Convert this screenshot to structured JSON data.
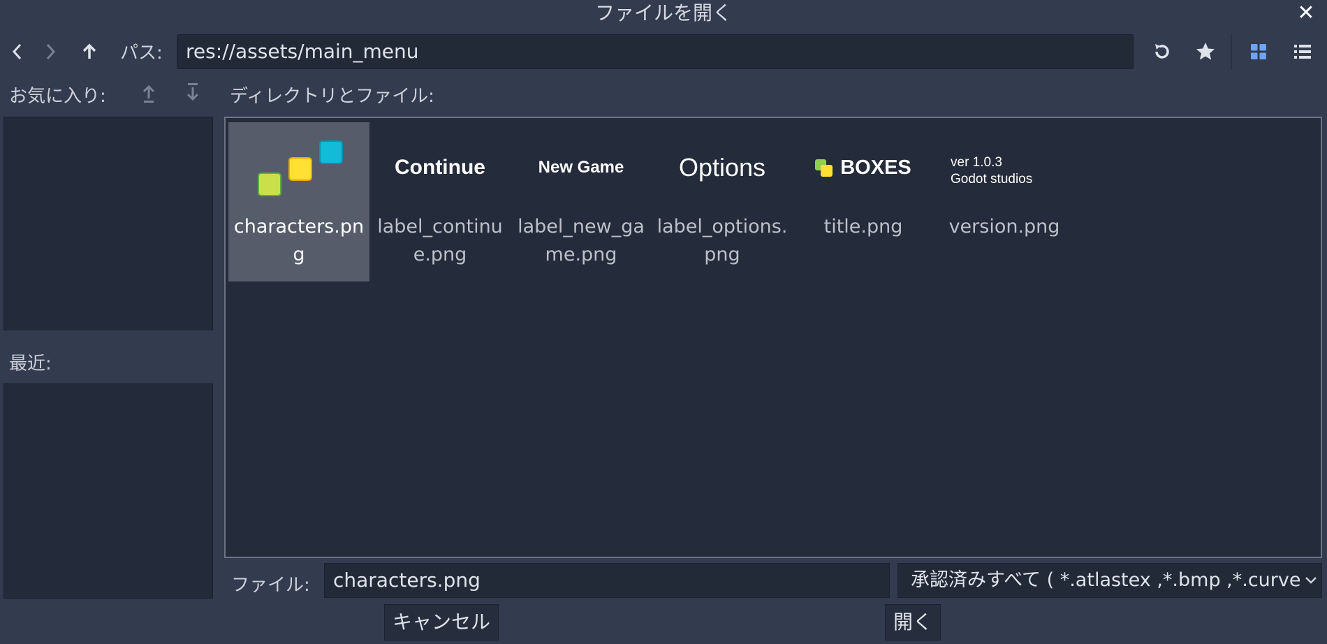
{
  "window": {
    "title": "ファイルを開く",
    "close_icon": "close-icon"
  },
  "toolbar": {
    "back_icon": "chevron-left-icon",
    "forward_icon": "chevron-right-icon",
    "up_icon": "arrow-up-icon",
    "path_label": "パス:",
    "path_value": "res://assets/main_menu",
    "refresh_icon": "refresh-icon",
    "favorite_icon": "star-icon",
    "grid_view_icon": "grid-view-icon",
    "list_view_icon": "list-view-icon"
  },
  "sidebar": {
    "favorites_label": "お気に入り:",
    "move_up_icon": "move-up-icon",
    "move_down_icon": "move-down-icon",
    "recent_label": "最近:"
  },
  "main": {
    "dir_label": "ディレクトリとファイル:",
    "files": [
      {
        "name": "characters.png",
        "selected": true
      },
      {
        "name": "label_continue.png",
        "thumb_text": "Continue"
      },
      {
        "name": "label_new_game.png",
        "thumb_text": "New Game"
      },
      {
        "name": "label_options.png",
        "thumb_text": "Options"
      },
      {
        "name": "title.png",
        "thumb_text": "BOXES"
      },
      {
        "name": "version.png",
        "thumb_text_1": "ver 1.0.3",
        "thumb_text_2": "Godot studios"
      }
    ]
  },
  "footer": {
    "file_label": "ファイル:",
    "file_value": "characters.png",
    "filter_value": "承認済みすべて ( *.atlastex ,*.bmp ,*.curvete",
    "filter_icon": "chevron-down-icon",
    "cancel_label": "キャンセル",
    "open_label": "開く"
  },
  "colors": {
    "background": "#333b4f",
    "panel": "#232a39",
    "selected": "#565c69",
    "accent": "#6fa3f5",
    "square_green": "#c9e04a",
    "square_yellow": "#ffe033",
    "square_cyan": "#10bcd8"
  }
}
